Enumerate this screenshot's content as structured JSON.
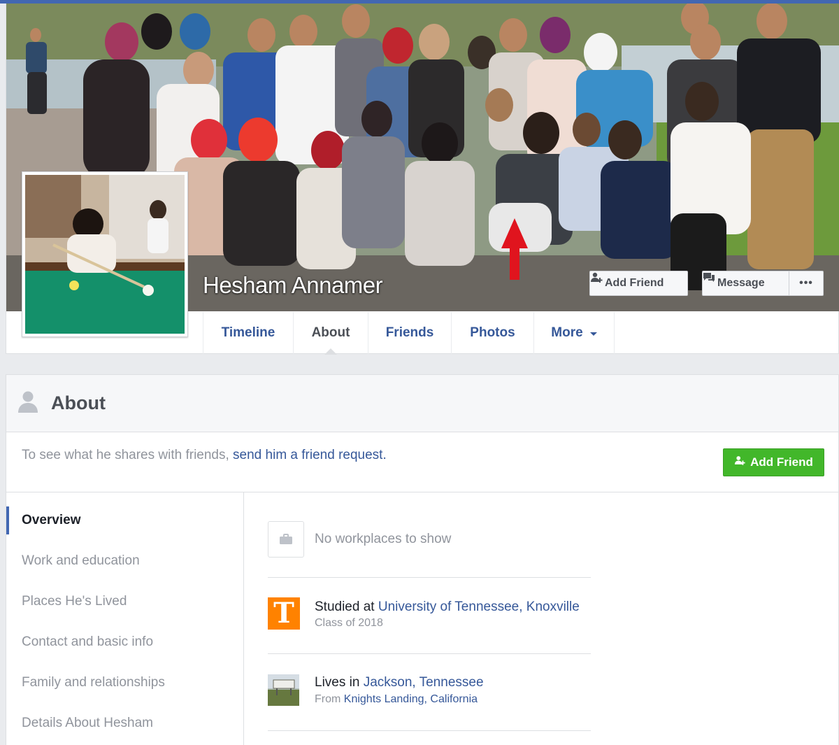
{
  "profile": {
    "name": "Hesham Annamer",
    "add_friend_label": "Add Friend",
    "message_label": "Message",
    "more_dots": "•••"
  },
  "tabs": [
    {
      "label": "Timeline"
    },
    {
      "label": "About"
    },
    {
      "label": "Friends"
    },
    {
      "label": "Photos"
    },
    {
      "label": "More"
    }
  ],
  "about": {
    "title": "About",
    "notice_prefix": "To see what he shares with friends, ",
    "notice_link": "send him a friend request.",
    "add_friend_label": "Add Friend"
  },
  "nav": [
    {
      "label": "Overview"
    },
    {
      "label": "Work and education"
    },
    {
      "label": "Places He's Lived"
    },
    {
      "label": "Contact and basic info"
    },
    {
      "label": "Family and relationships"
    },
    {
      "label": "Details About Hesham"
    }
  ],
  "overview": {
    "work": "No workplaces to show",
    "education": {
      "prefix": "Studied at ",
      "school": "University of Tennessee, Knoxville",
      "detail": "Class of 2018",
      "logo_letter": "T"
    },
    "residence": {
      "prefix": "Lives in ",
      "city": "Jackson, Tennessee",
      "from_prefix": "From ",
      "hometown": "Knights Landing, California"
    }
  },
  "colors": {
    "link": "#365899",
    "accent": "#4267b2",
    "green": "#42b72a",
    "ut_orange": "#ff8200",
    "arrow_red": "#e0141e"
  }
}
